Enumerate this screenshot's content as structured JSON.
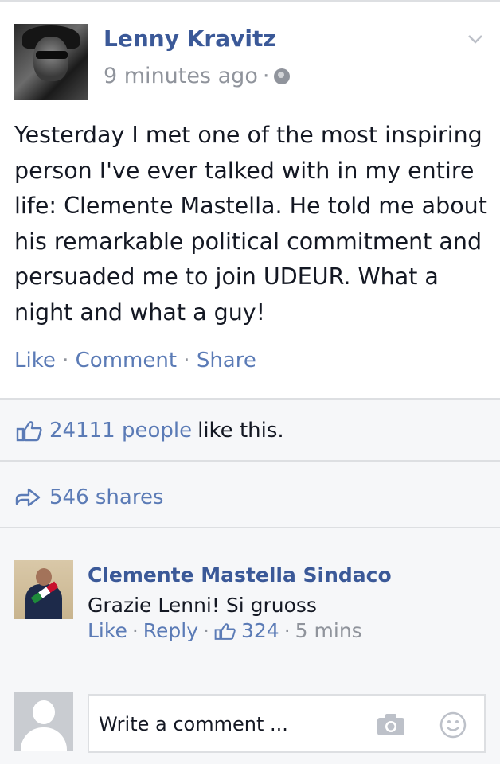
{
  "post": {
    "author": "Lenny Kravitz",
    "timestamp": "9 minutes ago",
    "separator": "·",
    "text": "Yesterday I met one of the most inspiring person I've ever talked with in my entire life: Clemente Mastella. He told me about his remarkable political commitment and persuaded me to join UDEUR. What a night and what a guy!",
    "actions": {
      "like": "Like",
      "comment": "Comment",
      "share": "Share",
      "sep": " · "
    }
  },
  "likes": {
    "count_link": "24111 people",
    "suffix": "like this."
  },
  "shares": {
    "label": "546 shares"
  },
  "comment": {
    "author": "Clemente Mastella Sindaco",
    "text": "Grazie Lenni! Si gruoss",
    "like": "Like",
    "reply": "Reply",
    "like_count": "324",
    "time": "5 mins",
    "sep": "·"
  },
  "compose": {
    "placeholder": "Write a comment ..."
  },
  "colors": {
    "link": "#3b5998",
    "action": "#5b7bb6",
    "muted": "#90949c",
    "text": "#141823",
    "section_bg": "#f6f7f9",
    "divider": "#dddfe2"
  },
  "icons": {
    "globe": "globe-icon",
    "chevron": "chevron-down-icon",
    "thumb": "thumbs-up-icon",
    "share": "share-arrow-icon",
    "camera": "camera-icon",
    "smiley": "smiley-icon"
  }
}
